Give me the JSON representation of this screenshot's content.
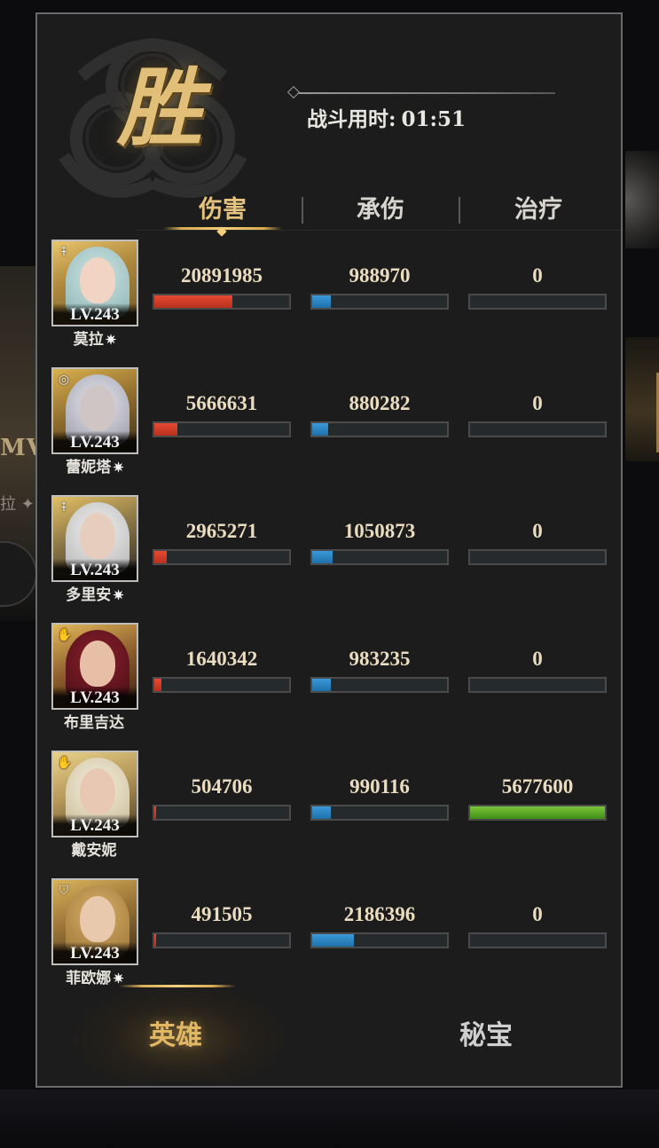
{
  "result": {
    "title": "胜"
  },
  "battle": {
    "time_label": "战斗用时:",
    "time_value": "01:51"
  },
  "tabs": [
    {
      "label": "伤害",
      "active": true
    },
    {
      "label": "承伤",
      "active": false
    },
    {
      "label": "治疗",
      "active": false
    }
  ],
  "heroes": [
    {
      "name": "莫拉",
      "level": "LV.243",
      "class_icon": "archer-icon",
      "star": "✷",
      "damage": "20891985",
      "taken": "988970",
      "heal": "0",
      "damage_pct": 58,
      "taken_pct": 14,
      "heal_pct": 0
    },
    {
      "name": "蕾妮塔",
      "level": "LV.243",
      "class_icon": "swirl-icon",
      "star": "✷",
      "damage": "5666631",
      "taken": "880282",
      "heal": "0",
      "damage_pct": 17,
      "taken_pct": 12,
      "heal_pct": 0
    },
    {
      "name": "多里安",
      "level": "LV.243",
      "class_icon": "archer-icon",
      "star": "✷",
      "damage": "2965271",
      "taken": "1050873",
      "heal": "0",
      "damage_pct": 9,
      "taken_pct": 15,
      "heal_pct": 0
    },
    {
      "name": "布里吉达",
      "level": "LV.243",
      "class_icon": "hand-icon",
      "star": "",
      "damage": "1640342",
      "taken": "983235",
      "heal": "0",
      "damage_pct": 5,
      "taken_pct": 14,
      "heal_pct": 0
    },
    {
      "name": "戴安妮",
      "level": "LV.243",
      "class_icon": "hand-icon",
      "star": "",
      "damage": "504706",
      "taken": "990116",
      "heal": "5677600",
      "damage_pct": 1,
      "taken_pct": 14,
      "heal_pct": 100
    },
    {
      "name": "菲欧娜",
      "level": "LV.243",
      "class_icon": "shield-icon",
      "star": "✷",
      "damage": "491505",
      "taken": "2186396",
      "heal": "0",
      "damage_pct": 1,
      "taken_pct": 31,
      "heal_pct": 0
    }
  ],
  "bottom_nav": [
    {
      "label": "英雄",
      "active": true
    },
    {
      "label": "秘宝",
      "active": false
    }
  ],
  "colors": {
    "gold": "#e2bf78",
    "damage_bar": "#d83f28",
    "taken_bar": "#2f8cc9",
    "heal_bar": "#62b42a"
  }
}
